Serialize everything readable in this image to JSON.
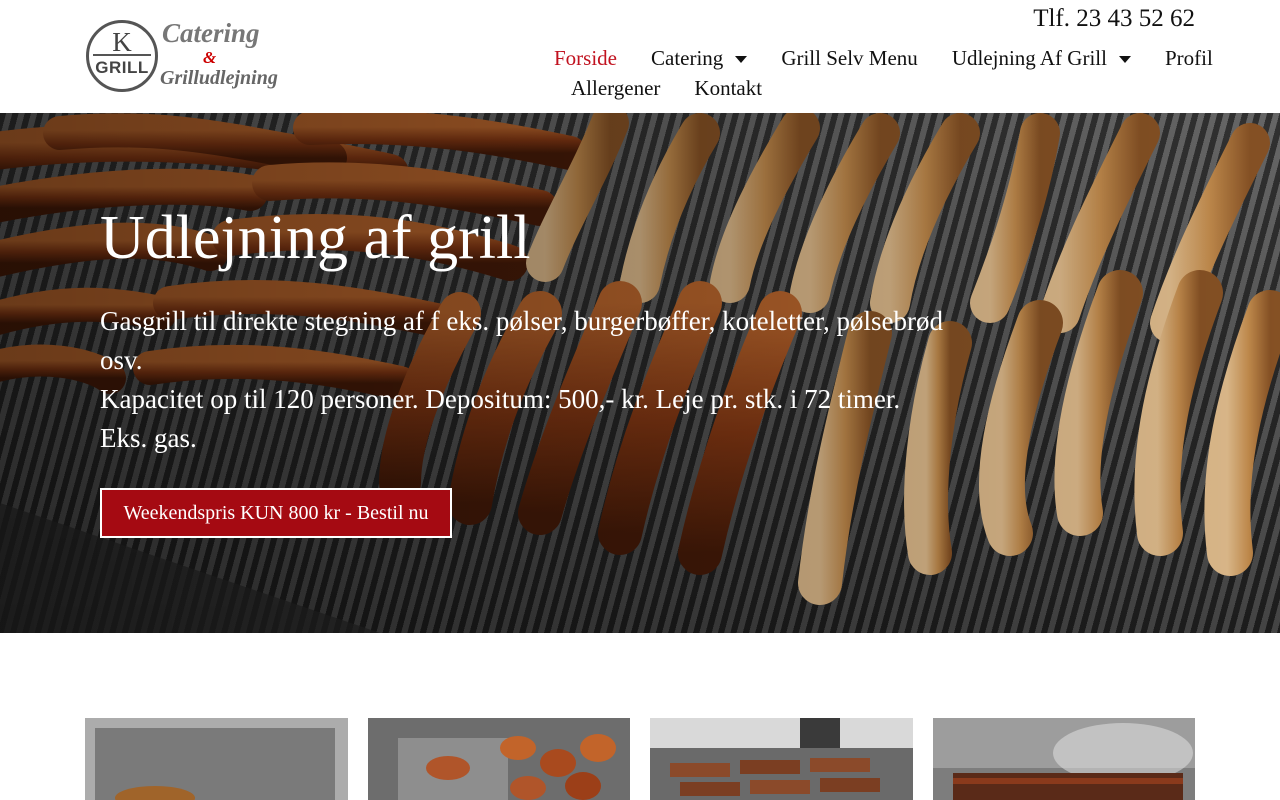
{
  "logo": {
    "k": "K",
    "grill": "GRILL",
    "catering": "Catering",
    "amp": "&",
    "subtitle": "Grilludlejning",
    "icon": "k-grill-logo-icon"
  },
  "header": {
    "phone": "Tlf. 23 43 52 62"
  },
  "nav": {
    "items": [
      {
        "label": "Forside",
        "active": true,
        "dropdown": false
      },
      {
        "label": "Catering",
        "active": false,
        "dropdown": true
      },
      {
        "label": "Grill Selv Menu",
        "active": false,
        "dropdown": false
      },
      {
        "label": "Udlejning Af Grill",
        "active": false,
        "dropdown": true
      },
      {
        "label": "Profil",
        "active": false,
        "dropdown": false
      },
      {
        "label": "Allergener",
        "active": false,
        "dropdown": false
      },
      {
        "label": "Kontakt",
        "active": false,
        "dropdown": false
      }
    ]
  },
  "hero": {
    "title": "Udlejning af grill",
    "line1": "Gasgrill til direkte stegning af f eks. pølser, burgerbøffer, koteletter, pølsebrød osv.",
    "line2": "Kapacitet op til 120 personer. Depositum: 500,- kr. Leje pr. stk. i 72 timer. Eks. gas.",
    "button": "Weekendspris KUN 800 kr - Bestil nu",
    "image": "sausages-on-grill-image"
  },
  "gallery": {
    "images": [
      "grill-roast-image",
      "grilled-chicken-image",
      "grilled-ribs-image",
      "smoking-grill-image"
    ]
  },
  "colors": {
    "accent": "#c1121f",
    "button": "#a50a12",
    "text": "#111111"
  }
}
